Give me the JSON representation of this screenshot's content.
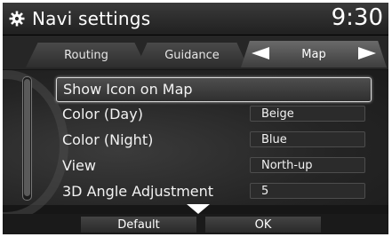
{
  "header": {
    "title": "Navi settings",
    "time": "9:30",
    "icon": "gear-icon"
  },
  "tabs": [
    {
      "label": "Routing",
      "active": false
    },
    {
      "label": "Guidance",
      "active": false
    },
    {
      "label": "Map",
      "active": true
    }
  ],
  "settings": [
    {
      "label": "Show Icon on Map",
      "value": null,
      "selected": true
    },
    {
      "label": "Color (Day)",
      "value": "Beige",
      "selected": false
    },
    {
      "label": "Color (Night)",
      "value": "Blue",
      "selected": false
    },
    {
      "label": "View",
      "value": "North-up",
      "selected": false
    },
    {
      "label": "3D Angle Adjustment",
      "value": "5",
      "selected": false
    }
  ],
  "footer": {
    "default_label": "Default",
    "ok_label": "OK"
  },
  "colors": {
    "background": "#161616",
    "text": "#f2f2f2",
    "highlight_border": "#d8d8d8"
  }
}
